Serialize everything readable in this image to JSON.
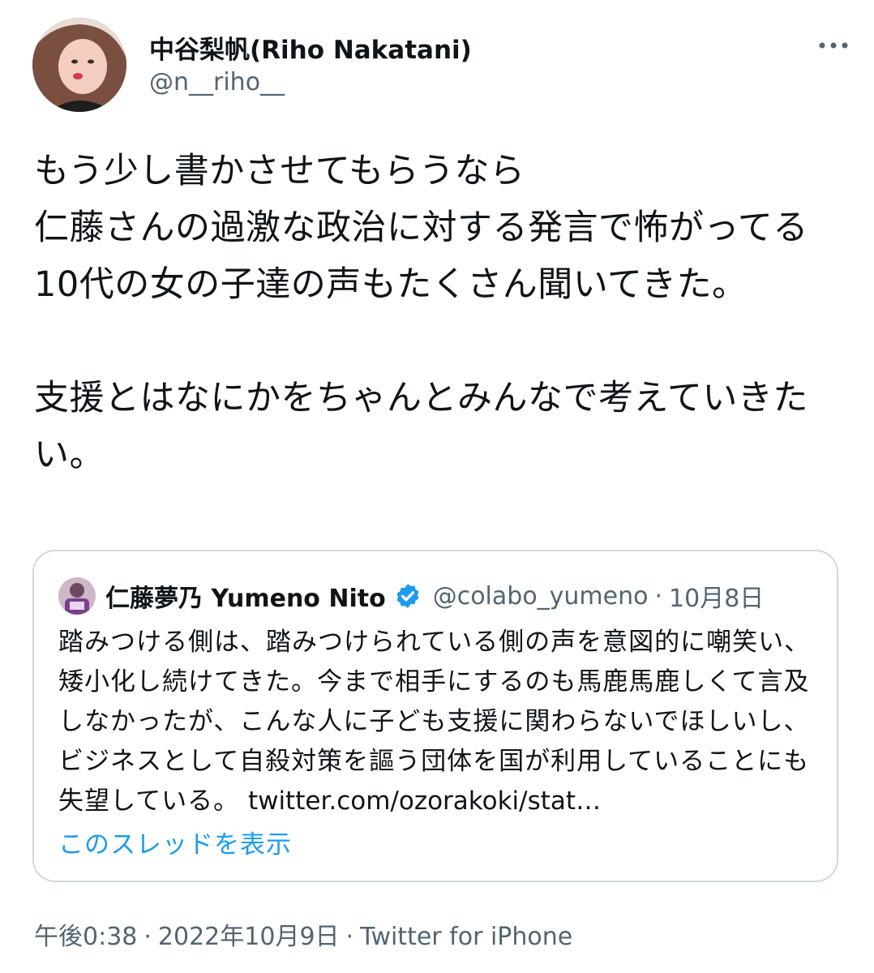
{
  "author": {
    "display_name": "中谷梨帆(Riho Nakatani)",
    "handle": "@n__riho__",
    "avatar_icon": "user-avatar-photo"
  },
  "more_icon": "more-horizontal-icon",
  "tweet": {
    "text": "もう少し書かさせてもらうなら\n仁藤さんの過激な政治に対する発言で怖がってる10代の女の子達の声もたくさん聞いてきた。\n\n支援とはなにかをちゃんとみんなで考えていきたい。"
  },
  "quoted_tweet": {
    "display_name": "仁藤夢乃 Yumeno Nito",
    "verified_icon": "verified-badge-icon",
    "handle": "@colabo_yumeno",
    "separator": "·",
    "date": "10月8日",
    "text": "踏みつける側は、踏みつけられている側の声を意図的に嘲笑い、矮小化し続けてきた。今まで相手にするのも馬鹿馬鹿しくて言及しなかったが、こんな人に子ども支援に関わらないでほしいし、ビジネスとして自殺対策を謳う団体を国が利用していることにも失望している。",
    "link": "twitter.com/ozorakoki/stat…",
    "show_thread": "このスレッドを表示"
  },
  "meta": {
    "time": "午後0:38",
    "separator": "·",
    "date": "2022年10月9日",
    "source": "Twitter for iPhone"
  },
  "colors": {
    "text": "#0f1419",
    "secondary": "#536471",
    "link": "#1d9bf0",
    "border": "#cfd9de"
  }
}
